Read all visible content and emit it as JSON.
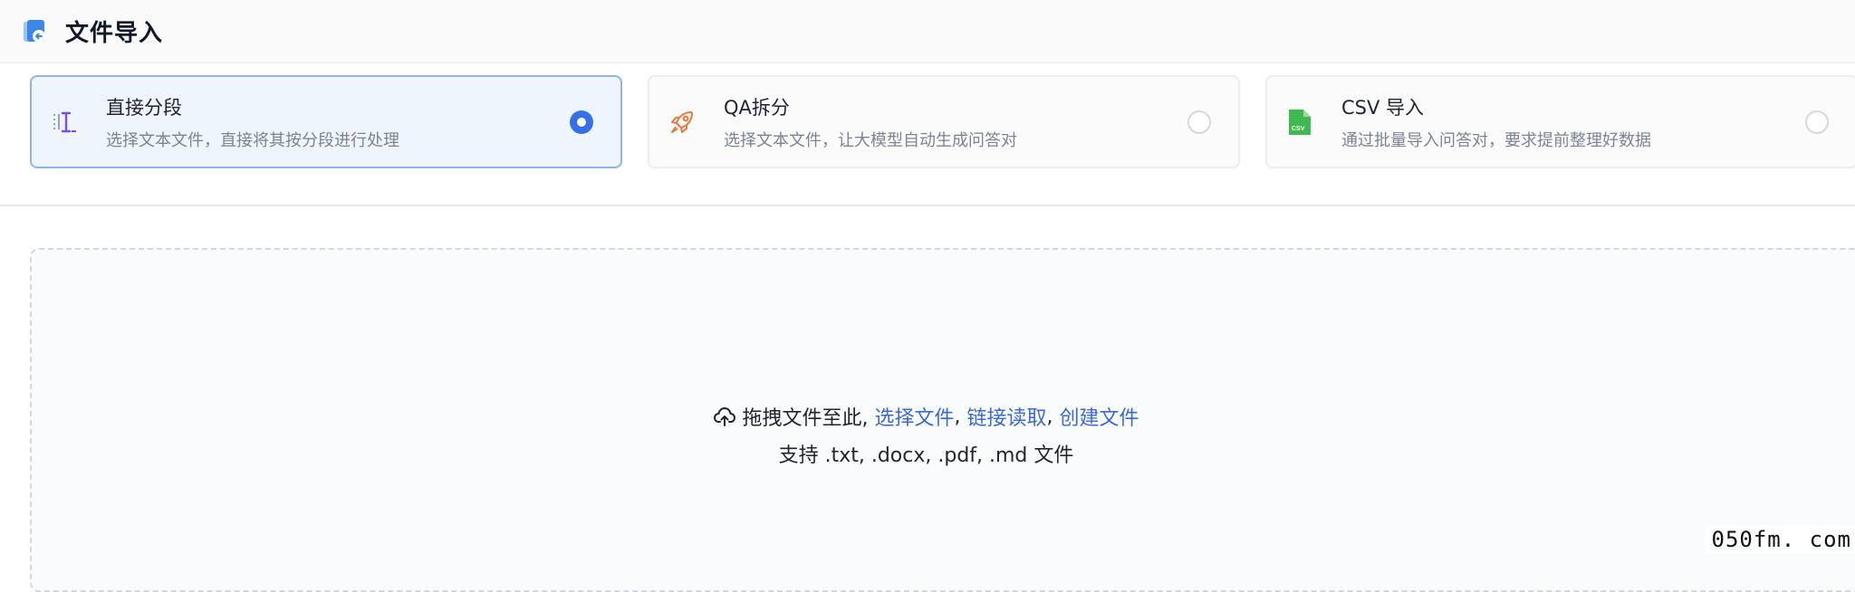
{
  "header": {
    "title": "文件导入",
    "icon": "file-import-icon"
  },
  "methods": [
    {
      "title": "直接分段",
      "desc": "选择文本文件，直接将其按分段进行处理",
      "icon": "split-text-icon",
      "selected": true
    },
    {
      "title": "QA拆分",
      "desc": "选择文本文件，让大模型自动生成问答对",
      "icon": "rocket-icon",
      "selected": false
    },
    {
      "title": "CSV 导入",
      "desc": "通过批量导入问答对，要求提前整理好数据",
      "icon": "csv-file-icon",
      "selected": false
    }
  ],
  "upload": {
    "prefix": "拖拽文件至此,",
    "select_file": "选择文件",
    "sep1": ",",
    "link_read": "链接读取",
    "sep2": ",",
    "create_file": "创建文件",
    "support": "支持 .txt, .docx, .pdf, .md 文件",
    "icon": "cloud-upload-icon"
  },
  "watermark": "050fm. com",
  "colors": {
    "accent": "#3670e8",
    "link": "#3a6ad8",
    "csv_green": "#3fb950",
    "rocket_orange": "#e8793a",
    "split_purple": "#7b4fd6"
  }
}
